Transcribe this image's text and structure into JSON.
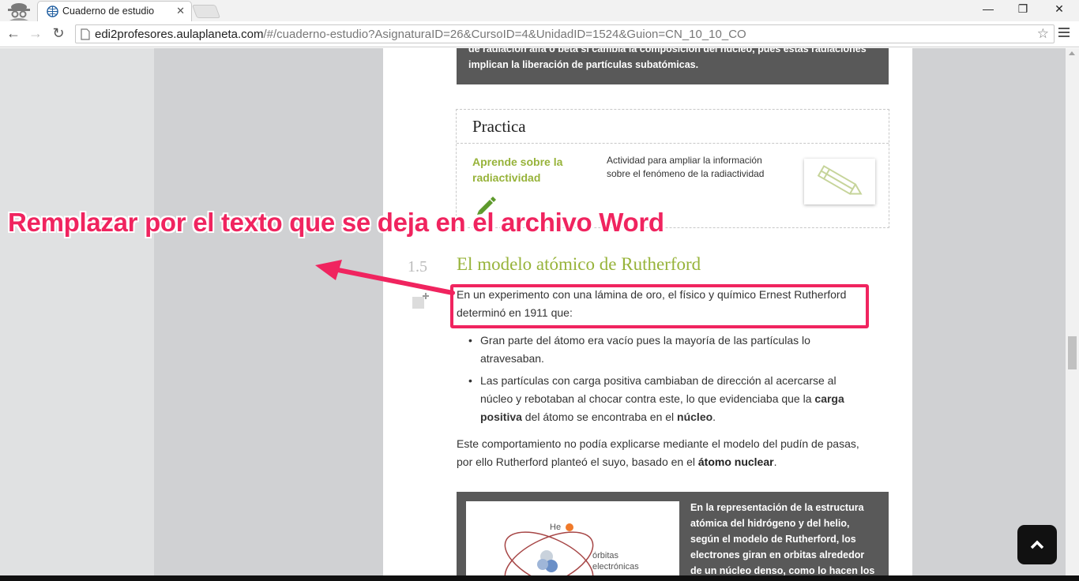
{
  "browser": {
    "tab_title": "Cuaderno de estudio",
    "url_host": "edi2profesores.aulaplaneta.com",
    "url_path": "/#/cuaderno-estudio?AsignaturaID=26&CursoID=4&UnidadID=1524&Guion=CN_10_10_CO",
    "icons": [
      "incognito-icon",
      "globe-icon",
      "close-icon",
      "back-icon",
      "forward-icon",
      "reload-icon",
      "page-icon",
      "star-icon",
      "menu-icon"
    ],
    "window_buttons": [
      "minimize",
      "restore",
      "close"
    ]
  },
  "content": {
    "prev_box": {
      "line1": "de radiación alfa o beta si cambia la composición del núcleo, pues estas radiaciones",
      "line2": "implican la liberación de partículas subatómicas."
    },
    "practica": {
      "heading": "Practica",
      "activity_title": "Aprende sobre la radiactividad",
      "activity_desc": "Actividad para ampliar la información sobre el fenómeno de la radiactividad"
    },
    "section": {
      "number": "1.5",
      "title": "El modelo atómico de Rutherford",
      "intro": "En un experimento con una lámina de oro, el físico y químico Ernest Rutherford determinó en 1911 que:",
      "bullet1": "Gran parte del átomo era vacío pues la mayoría de las partículas lo atravesaban.",
      "bullet2_a": "Las partículas con carga positiva cambiaban de dirección al acercarse al núcleo y rebotaban al chocar contra este, lo que evidenciaba que la ",
      "bullet2_b": "carga positiva",
      "bullet2_c": " del átomo se encontraba en el ",
      "bullet2_d": "núcleo",
      "bullet2_e": ".",
      "para_a": "Este comportamiento no podía explicarse mediante el modelo del pudín de pasas, por ello Rutherford planteó el suyo, basado en el ",
      "para_b": "átomo nuclear",
      "para_c": "."
    },
    "figure": {
      "label_he": "He",
      "label_orbitas": "órbitas",
      "label_electronicas": "electrónicas",
      "caption": "En la representación de la estructura atómica del hidrógeno y del helio, según el modelo de Rutherford, los electrones giran en orbitas alrededor de un núcleo denso, como lo hacen los"
    }
  },
  "annotation": {
    "text": "Remplazar por el texto que se deja en el archivo Word",
    "color": "#f0245f"
  },
  "colors": {
    "accent_green": "#97b33a",
    "dark_box": "#595959",
    "page_bg": "#d0d1d3"
  }
}
